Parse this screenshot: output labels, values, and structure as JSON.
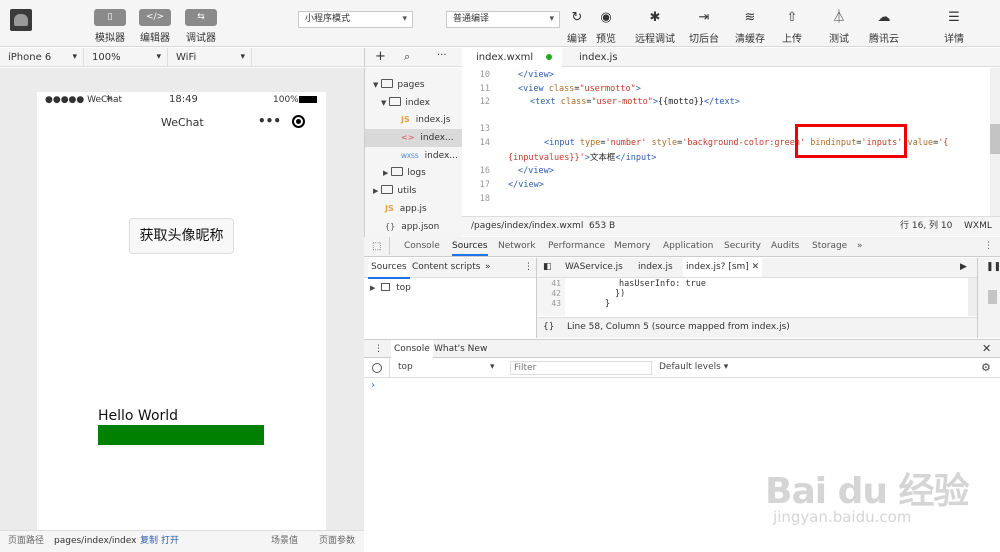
{
  "toolbar": {
    "simulator": "模拟器",
    "editor": "编辑器",
    "debugger": "调试器",
    "mode": "小程序模式",
    "compile_mode": "普通编译",
    "compile": "编译",
    "preview": "预览",
    "remote_debug": "远程调试",
    "background": "切后台",
    "clear_cache": "清缓存",
    "upload": "上传",
    "test": "测试",
    "tencent_cloud": "腾讯云",
    "details": "详情"
  },
  "device": {
    "model": "iPhone 6",
    "zoom": "100%",
    "network": "WiFi"
  },
  "phone": {
    "carrier": "●●●●● WeChat",
    "time": "18:49",
    "battery": "100%",
    "nav_title": "WeChat",
    "button_label": "获取头像昵称",
    "hello": "Hello World"
  },
  "bottom": {
    "path_label": "页面路径",
    "path": "pages/index/index",
    "copy": "复制",
    "open": "打开",
    "scene": "场景值",
    "params": "页面参数"
  },
  "files": {
    "pages": "pages",
    "index": "index",
    "index_js": "index.js",
    "index_wxml": "index...",
    "index_wxss": "index...",
    "logs": "logs",
    "utils": "utils",
    "app_js": "app.js",
    "app_json": "app.json",
    "js_tag": "JS",
    "wxml_tag": "<>",
    "wxss_tag": "WXSS"
  },
  "editor": {
    "tab1": "index.wxml",
    "tab2": "index.js",
    "lines": [
      "10",
      "11",
      "12",
      "13",
      "14",
      "15",
      "",
      "16",
      "17",
      "18"
    ],
    "status_path": "/pages/index/index.wxml",
    "status_size": "653 B",
    "cursor": "行 16, 列 10",
    "lang": "WXML"
  },
  "devtools": {
    "tabs": [
      "Console",
      "Sources",
      "Network",
      "Performance",
      "Memory",
      "Application",
      "Security",
      "Audits",
      "Storage"
    ],
    "src_tabs": [
      "Sources",
      "Content scripts"
    ],
    "open_files": [
      "WAService.js",
      "index.js",
      "index.js? [sm]"
    ],
    "tree_top": "top",
    "code_lines": [
      "41",
      "42",
      "43",
      "44"
    ],
    "code_text": [
      "hasUserInfo: true",
      "})",
      "}",
      "})"
    ],
    "status": "Line 58, Column 5  (source mapped from index.js)",
    "console_tabs": [
      "Console",
      "What's New"
    ],
    "context": "top",
    "filter_placeholder": "Filter",
    "levels": "Default levels"
  },
  "watermark": {
    "brand": "Bai du 经验",
    "url": "jingyan.baidu.com"
  }
}
